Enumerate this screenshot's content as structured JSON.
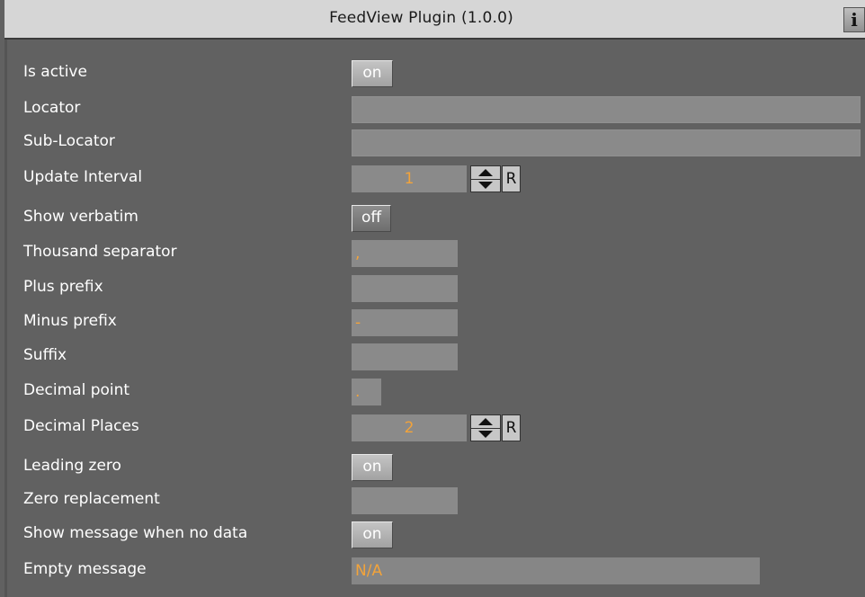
{
  "window": {
    "title": "FeedView Plugin (1.0.0)",
    "info_button": "i"
  },
  "fields": {
    "is_active": {
      "label": "Is active",
      "value": "on"
    },
    "locator": {
      "label": "Locator",
      "value": ""
    },
    "sub_locator": {
      "label": "Sub-Locator",
      "value": ""
    },
    "update_interval": {
      "label": "Update Interval",
      "value": "1",
      "reset": "R"
    },
    "show_verbatim": {
      "label": "Show verbatim",
      "value": "off"
    },
    "thousand_separator": {
      "label": "Thousand separator",
      "value": ","
    },
    "plus_prefix": {
      "label": "Plus prefix",
      "value": ""
    },
    "minus_prefix": {
      "label": "Minus prefix",
      "value": "-"
    },
    "suffix": {
      "label": "Suffix",
      "value": ""
    },
    "decimal_point": {
      "label": "Decimal point",
      "value": "."
    },
    "decimal_places": {
      "label": "Decimal Places",
      "value": "2",
      "reset": "R"
    },
    "leading_zero": {
      "label": "Leading zero",
      "value": "on"
    },
    "zero_replacement": {
      "label": "Zero replacement",
      "value": ""
    },
    "show_message_no_data": {
      "label": "Show message when no data",
      "value": "on"
    },
    "empty_message": {
      "label": "Empty message",
      "value": "N/A"
    }
  },
  "icons": {
    "info": "info-icon",
    "spinner": "up-down-arrows-icon"
  },
  "colors": {
    "panel_bg": "#616161",
    "field_bg": "#8a8a8a",
    "value_text": "#f2a33a",
    "titlebar_bg": "#d6d6d6"
  }
}
